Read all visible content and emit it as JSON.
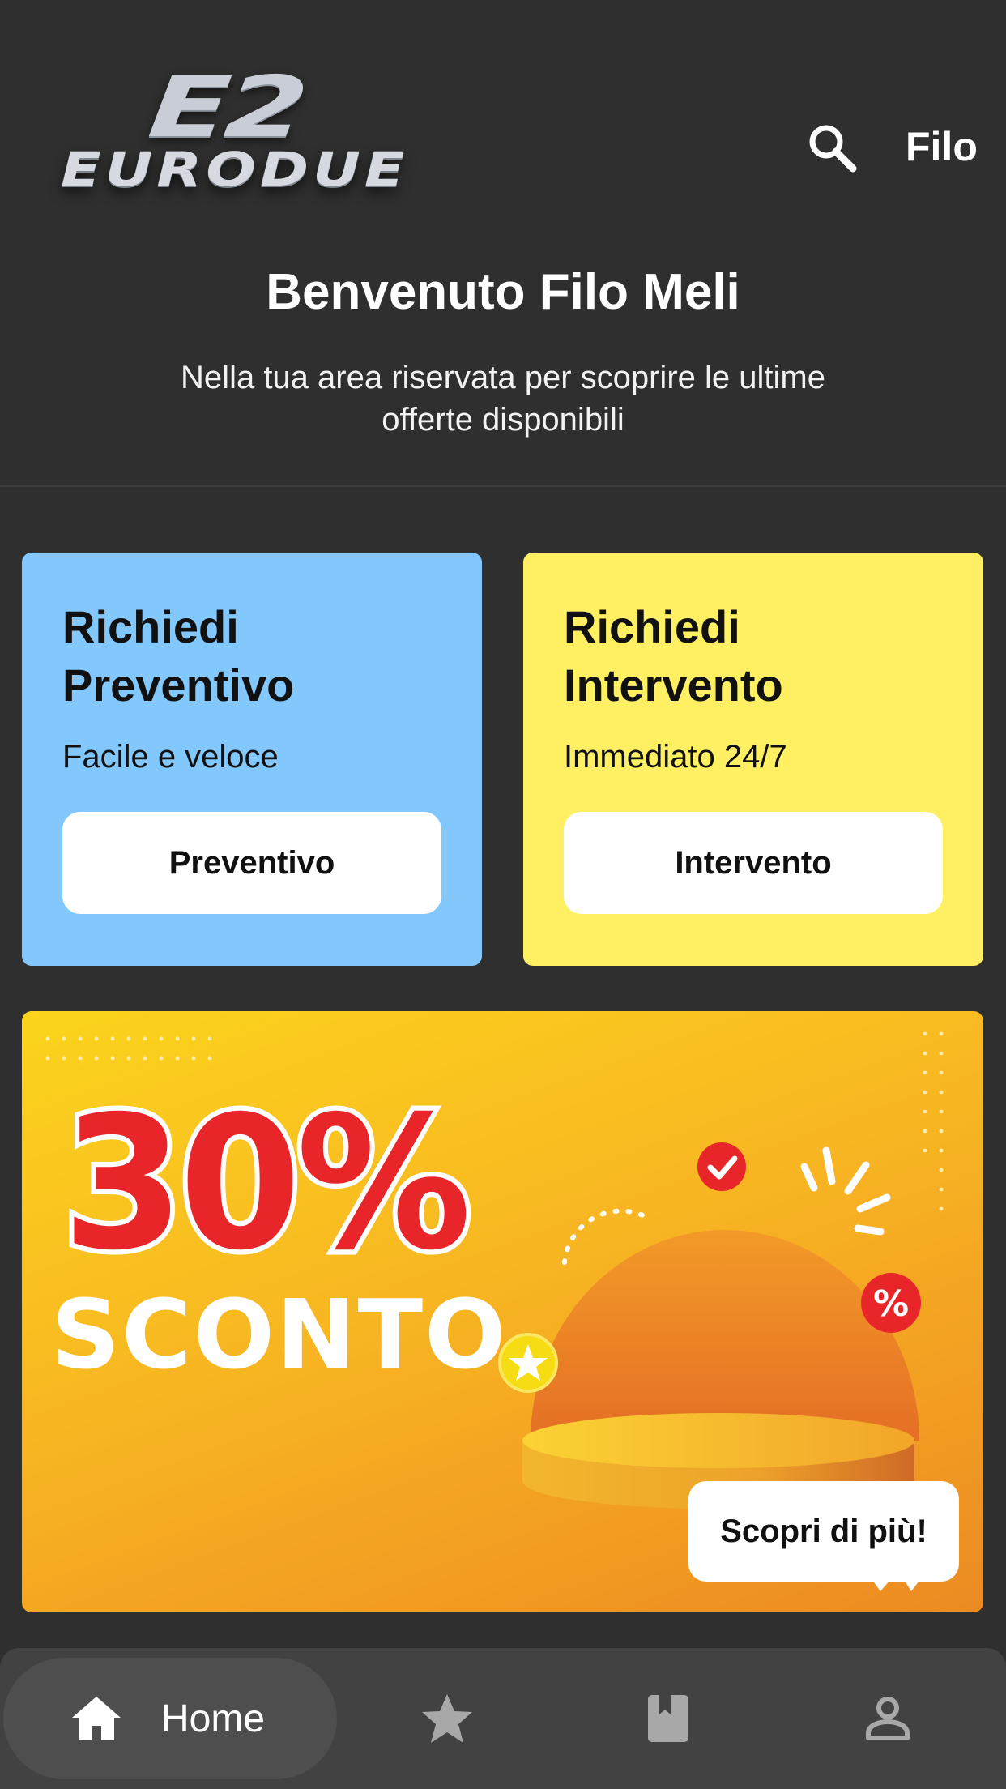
{
  "header": {
    "logo_mark": "E2",
    "logo_text": "EURODUE",
    "username": "Filo"
  },
  "welcome": {
    "title": "Benvenuto Filo Meli",
    "subtitle": "Nella tua area riservata per scoprire le ultime offerte disponibili"
  },
  "cards": [
    {
      "title": "Richiedi Preventivo",
      "subtitle": "Facile e veloce",
      "button": "Preventivo",
      "color": "#82c8fd"
    },
    {
      "title": "Richiedi Intervento",
      "subtitle": "Immediato 24/7",
      "button": "Intervento",
      "color": "#fef062"
    }
  ],
  "promo": {
    "headline": "30%",
    "word": "SCONTO",
    "button": "Scopri di più!",
    "colors": {
      "red": "#e8262a",
      "yellow": "#fbd41c",
      "orange": "#ec8a22"
    }
  },
  "bottom_nav": {
    "active": "home",
    "items": [
      {
        "id": "home",
        "label": "Home",
        "icon": "home-icon"
      },
      {
        "id": "favorites",
        "label": "",
        "icon": "star-icon"
      },
      {
        "id": "catalog",
        "label": "",
        "icon": "bookmark-book-icon"
      },
      {
        "id": "profile",
        "label": "",
        "icon": "person-icon"
      }
    ]
  }
}
